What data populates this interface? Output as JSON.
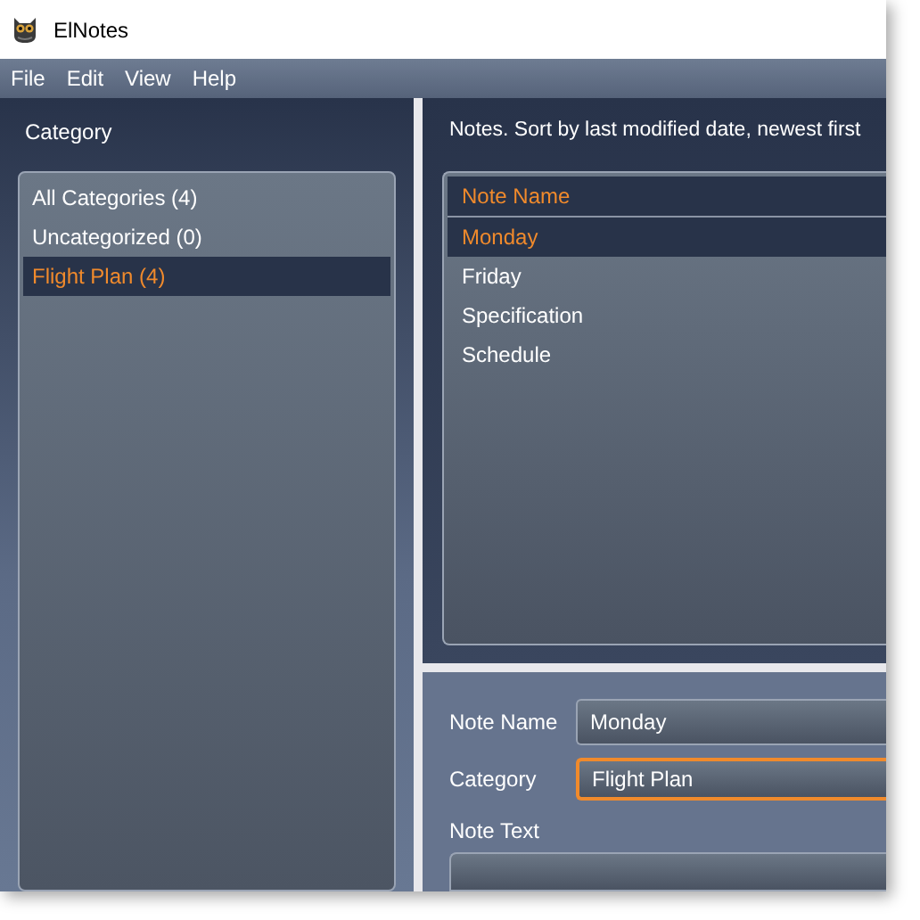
{
  "window": {
    "title": "ElNotes"
  },
  "menu": [
    "File",
    "Edit",
    "View",
    "Help"
  ],
  "category_panel": {
    "heading": "Category",
    "items": [
      {
        "label": "All Categories (4)",
        "selected": false
      },
      {
        "label": "Uncategorized (0)",
        "selected": false
      },
      {
        "label": "Flight Plan (4)",
        "selected": true
      }
    ]
  },
  "notes_panel": {
    "heading": "Notes. Sort by last modified date, newest first",
    "column": "Note Name",
    "rows": [
      {
        "label": "Monday",
        "selected": true
      },
      {
        "label": "Friday",
        "selected": false
      },
      {
        "label": "Specification",
        "selected": false
      },
      {
        "label": "Schedule",
        "selected": false
      }
    ]
  },
  "editor": {
    "fields": [
      {
        "label": "Note Name",
        "value": "Monday",
        "focused": false
      },
      {
        "label": "Category",
        "value": "Flight Plan",
        "focused": true
      }
    ],
    "text_label": "Note Text"
  }
}
